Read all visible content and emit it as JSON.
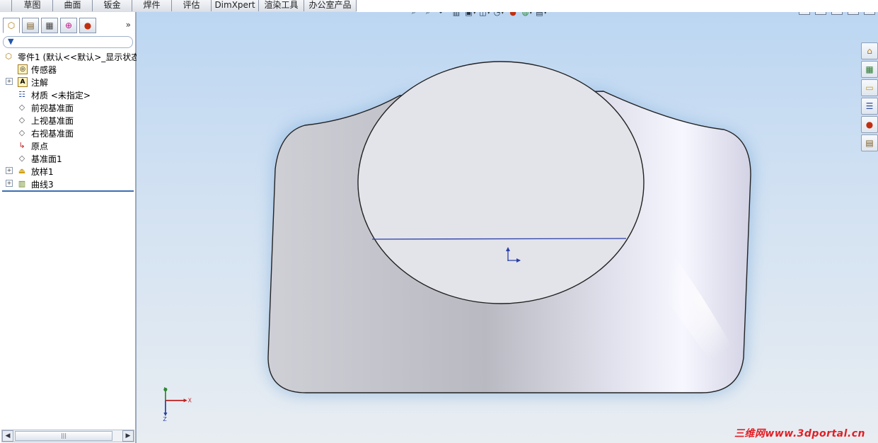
{
  "command_tabs": [
    "草图",
    "曲面",
    "钣金",
    "焊件",
    "评估",
    "DimXpert",
    "渲染工具",
    "办公室产品"
  ],
  "feature_tree": {
    "root": "零件1 (默认<<默认>_显示状态",
    "items": [
      {
        "label": "传感器",
        "expandable": false,
        "icon": "sensor-icon"
      },
      {
        "label": "注解",
        "expandable": true,
        "icon": "annotation-icon"
      },
      {
        "label": "材质 <未指定>",
        "expandable": false,
        "icon": "material-icon"
      },
      {
        "label": "前视基准面",
        "expandable": false,
        "icon": "plane-icon"
      },
      {
        "label": "上视基准面",
        "expandable": false,
        "icon": "plane-icon"
      },
      {
        "label": "右视基准面",
        "expandable": false,
        "icon": "plane-icon"
      },
      {
        "label": "原点",
        "expandable": false,
        "icon": "origin-icon"
      },
      {
        "label": "基准面1",
        "expandable": false,
        "icon": "plane-icon"
      },
      {
        "label": "放样1",
        "expandable": true,
        "icon": "loft-icon"
      },
      {
        "label": "曲线3",
        "expandable": true,
        "icon": "curve-icon"
      }
    ]
  },
  "panel": {
    "expand_label": "»",
    "tab_icons": [
      "feature-manager-icon",
      "property-manager-icon",
      "configuration-manager-icon",
      "dimxpert-icon",
      "display-manager-icon"
    ]
  },
  "triad": {
    "x": "X",
    "y": "Y",
    "z": "Z"
  },
  "watermark": "三维网www.3dportal.cn",
  "colors": {
    "viewport_top": "#bcd6f2",
    "viewport_bottom": "#e8edf2",
    "accent_blue": "#2a3fa8",
    "watermark_red": "#e31e24"
  }
}
